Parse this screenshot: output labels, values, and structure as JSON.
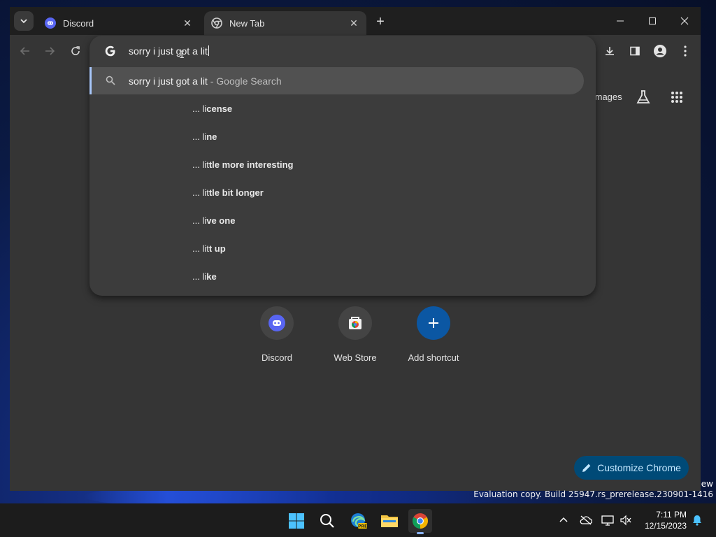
{
  "tabs": [
    {
      "title": "Discord",
      "active": false
    },
    {
      "title": "New Tab",
      "active": true
    }
  ],
  "omnibox": {
    "input_text": "sorry i just got a lit",
    "selected": {
      "query": "sorry i just got a lit",
      "suffix": " - Google Search"
    },
    "suggestions": [
      {
        "prefix": "... li",
        "bold": "cense"
      },
      {
        "prefix": "... li",
        "bold": "ne"
      },
      {
        "prefix": "... lit",
        "bold": "tle more interesting"
      },
      {
        "prefix": "... lit",
        "bold": "tle bit longer"
      },
      {
        "prefix": "... li",
        "bold": "ve one"
      },
      {
        "prefix": "... lit",
        "bold": "t up"
      },
      {
        "prefix": "... li",
        "bold": "ke"
      }
    ]
  },
  "ntp": {
    "images_link": "Images",
    "shortcuts": [
      {
        "label": "Discord",
        "icon": "discord-icon"
      },
      {
        "label": "Web Store",
        "icon": "web-store-icon"
      },
      {
        "label": "Add shortcut",
        "icon": "plus-icon"
      }
    ],
    "customize_label": "Customize Chrome"
  },
  "watermark": {
    "line": "Evaluation copy. Build 25947.rs_prerelease.230901-1416",
    "edge_text": "iew"
  },
  "taskbar": {
    "time": "7:11 PM",
    "date": "12/15/2023"
  },
  "colors": {
    "accent": "#a8c7fa",
    "customize_bg": "#004a77",
    "discord": "#5865f2"
  }
}
